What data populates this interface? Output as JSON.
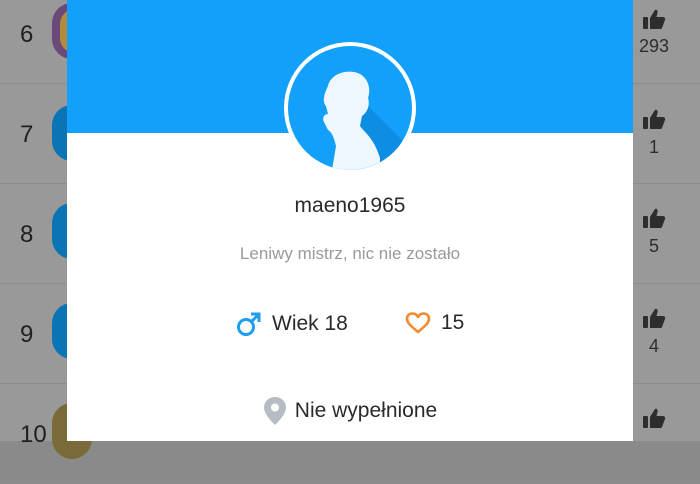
{
  "leaderboard": {
    "rows": [
      {
        "rank": "6",
        "likes": "293"
      },
      {
        "rank": "7",
        "likes": "1"
      },
      {
        "rank": "8",
        "likes": "5"
      },
      {
        "rank": "9",
        "likes": "4"
      },
      {
        "rank": "10",
        "likes": ""
      }
    ]
  },
  "profile": {
    "username": "maeno1965",
    "bio": "Leniwy mistrz, nic nie zostało",
    "age_label": "Wiek 18",
    "likes": "15",
    "location": "Nie wypełnione"
  },
  "colors": {
    "header": "#12a0fb",
    "male_icon": "#1e9ef0",
    "heart_icon": "#f5892c",
    "location_icon": "#b5bcc3"
  },
  "icons": {
    "avatar": "default-avatar-silhouette-icon",
    "gender": "male-symbol-icon",
    "likes": "heart-outline-icon",
    "location": "location-pin-icon",
    "row_like": "thumbs-up-icon"
  }
}
